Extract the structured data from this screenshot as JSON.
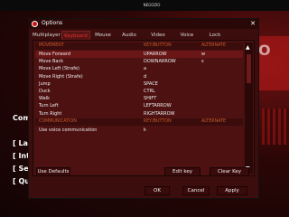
{
  "background": {
    "title": "NEGOZIO",
    "brand": "O",
    "menu": [
      "Comp",
      "[ Lan",
      "[ Inte",
      "[ Sett",
      "[ Quit"
    ]
  },
  "dialog": {
    "title": "Options",
    "tabs": [
      "Multiplayer",
      "Keyboard",
      "Mouse",
      "Audio",
      "Video",
      "Voice",
      "Lock"
    ],
    "active_tab": "Keyboard",
    "headers": {
      "movement": [
        "MOVEMENT",
        "KEY/BUTTON",
        "ALTERNATE"
      ],
      "communication": [
        "COMMUNICATION",
        "KEY/BUTTON",
        "ALTERNATE"
      ]
    },
    "rows": [
      {
        "action": "Move Forward",
        "key": "UPARROW",
        "alt": "w",
        "selected": true
      },
      {
        "action": "Move Back",
        "key": "DOWNARROW",
        "alt": "s"
      },
      {
        "action": "Move Left (Strafe)",
        "key": "a",
        "alt": ""
      },
      {
        "action": "Move Right (Strafe)",
        "key": "d",
        "alt": ""
      },
      {
        "action": "Jump",
        "key": "SPACE",
        "alt": ""
      },
      {
        "action": "Duck",
        "key": "CTRL",
        "alt": ""
      },
      {
        "action": "Walk",
        "key": "SHIFT",
        "alt": ""
      },
      {
        "action": "Turn Left",
        "key": "LEFTARROW",
        "alt": ""
      },
      {
        "action": "Turn Right",
        "key": "RIGHTARROW",
        "alt": ""
      }
    ],
    "comm_rows": [
      {
        "action": "Use voice communication",
        "key": "k",
        "alt": ""
      }
    ],
    "buttons": {
      "use_defaults": "Use Defaults",
      "edit_key": "Edit key",
      "clear_key": "Clear Key",
      "ok": "OK",
      "cancel": "Cancel",
      "apply": "Apply"
    },
    "colors": {
      "accent": "#e03030",
      "header": "#c85a2a"
    }
  }
}
